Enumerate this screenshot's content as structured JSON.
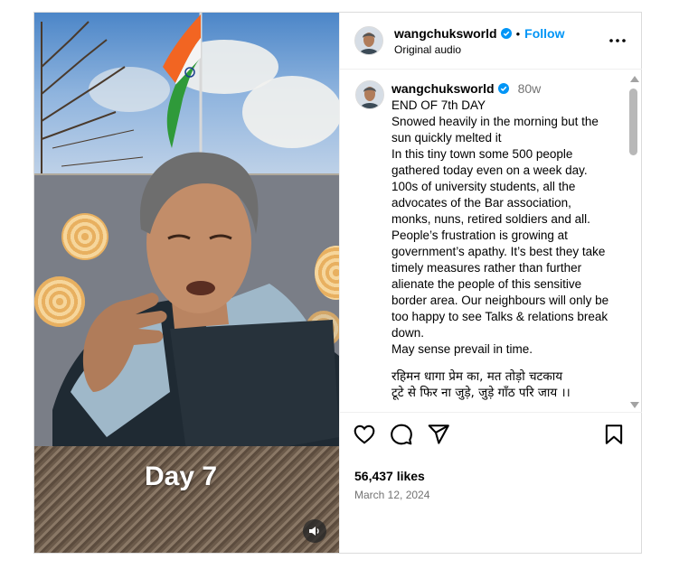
{
  "post": {
    "username": "wangchuksworld",
    "follow_label": "Follow",
    "separator": "•",
    "audio_label": "Original audio",
    "time_ago": "80w",
    "caption": "END OF 7th  DAY\nSnowed heavily in the morning but the sun quickly melted it\nIn this tiny town some 500 people gathered today even on a week day.\n100s of university students, all the advocates of the Bar association, monks, nuns, retired soldiers and all.\nPeople’s frustration is growing at government’s apathy. It’s best they take timely measures rather than further alienate the people of this sensitive border area. Our neighbours will only be too happy to see Talks & relations break down.\nMay sense prevail in time.",
    "hindi_couplet": "रहिमन धागा प्रेम का, मत तोड़ो चटकाय\n टूटे से फिर ना जुड़े, जुड़े गाँठ परि जाय ।।",
    "likes": "56,437 likes",
    "date": "March 12, 2024"
  },
  "media": {
    "overlay_text": "Day 7"
  },
  "icons": {
    "verified": "verified-badge-icon",
    "more": "more-options-icon",
    "like": "heart-icon",
    "comment": "comment-icon",
    "share": "share-icon",
    "save": "bookmark-icon",
    "sound": "speaker-icon"
  },
  "colors": {
    "accent": "#0095f6",
    "muted": "#737373"
  }
}
